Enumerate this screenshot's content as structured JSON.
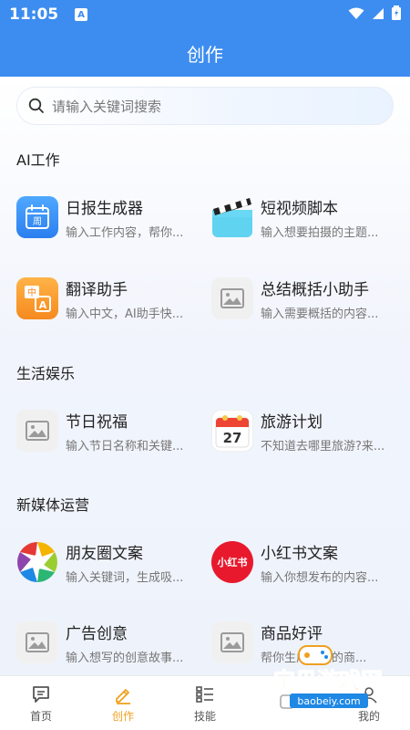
{
  "status": {
    "time": "11:05",
    "badge": "A"
  },
  "header": {
    "title": "创作"
  },
  "search": {
    "placeholder": "请输入关键词搜索"
  },
  "sections": [
    {
      "title": "AI工作"
    },
    {
      "title": "生活娱乐"
    },
    {
      "title": "新媒体运营"
    }
  ],
  "tools": {
    "daily_report": {
      "title": "日报生成器",
      "desc": "输入工作内容，帮你...",
      "icon_text": "周"
    },
    "short_video": {
      "title": "短视频脚本",
      "desc": "输入想要拍摄的主题..."
    },
    "translate": {
      "title": "翻译助手",
      "desc": "输入中文，AI助手快...",
      "icon_text_zh": "中",
      "icon_text_a": "A"
    },
    "summary": {
      "title": "总结概括小助手",
      "desc": "输入需要概括的内容..."
    },
    "holiday": {
      "title": "节日祝福",
      "desc": "输入节日名称和关键..."
    },
    "travel": {
      "title": "旅游计划",
      "desc": "不知道去哪里旅游?来...",
      "icon_text": "27"
    },
    "moments": {
      "title": "朋友圈文案",
      "desc": "输入关键词，生成吸..."
    },
    "xiaohongshu": {
      "title": "小红书文案",
      "desc": "输入你想发布的内容...",
      "icon_text": "小红书"
    },
    "ad": {
      "title": "广告创意",
      "desc": "输入想写的创意故事..."
    },
    "review": {
      "title": "商品好评",
      "desc": "帮你生成真实的商..."
    }
  },
  "tabs": [
    {
      "label": "首页"
    },
    {
      "label": "创作"
    },
    {
      "label": "技能"
    },
    {
      "label": ""
    },
    {
      "label": "我的"
    }
  ],
  "watermark": {
    "line1": "宝贝游戏网",
    "line2": "baobeiy.com"
  },
  "colors": {
    "primary": "#3d8df0",
    "active_tab": "#f0a020"
  }
}
